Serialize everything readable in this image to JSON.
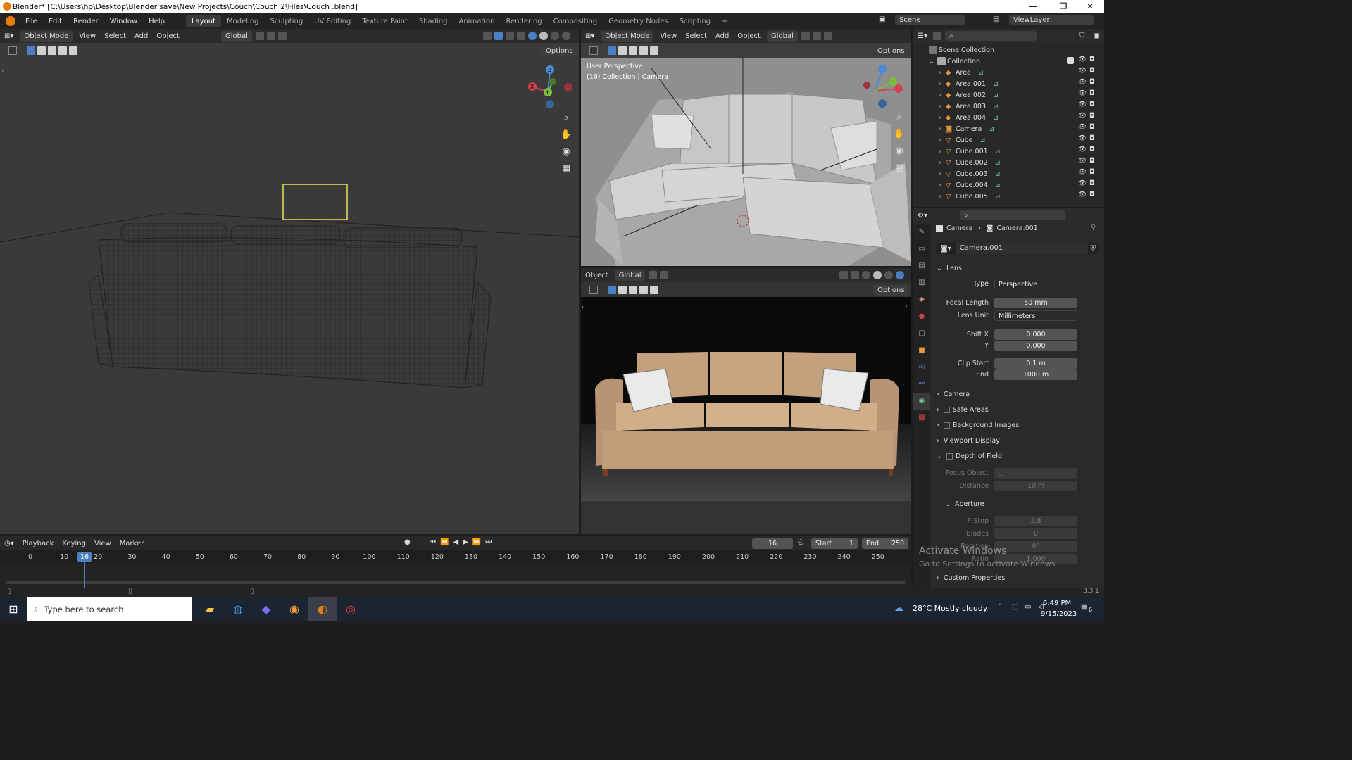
{
  "window": {
    "title": "Blender* [C:\\Users\\hp\\Desktop\\Blender save\\New Projects\\Couch\\Couch 2\\Files\\Couch .blend]",
    "minimize": "—",
    "maximize": "❐",
    "close": "✕"
  },
  "menus": [
    "File",
    "Edit",
    "Render",
    "Window",
    "Help"
  ],
  "workspaces": [
    "Layout",
    "Modeling",
    "Sculpting",
    "UV Editing",
    "Texture Paint",
    "Shading",
    "Animation",
    "Rendering",
    "Compositing",
    "Geometry Nodes",
    "Scripting"
  ],
  "scene": {
    "label": "Scene",
    "view_layer": "ViewLayer"
  },
  "left_viewport": {
    "mode": "Object Mode",
    "menus": [
      "View",
      "Select",
      "Add",
      "Object"
    ],
    "orientation": "Global",
    "options": "Options"
  },
  "right_top_viewport": {
    "mode": "Object Mode",
    "menus": [
      "View",
      "Select",
      "Add",
      "Object"
    ],
    "orientation": "Global",
    "options": "Options",
    "overlay_line1": "User Perspective",
    "overlay_line2": "(16) Collection | Camera"
  },
  "right_bottom_viewport": {
    "menu": "Object",
    "orientation": "Global",
    "options": "Options"
  },
  "gizmo": {
    "z": "Z",
    "y": "Y",
    "x": "X"
  },
  "outliner": {
    "scene_collection": "Scene Collection",
    "collection": "Collection",
    "items": [
      {
        "name": "Area",
        "type": "light"
      },
      {
        "name": "Area.001",
        "type": "light"
      },
      {
        "name": "Area.002",
        "type": "light"
      },
      {
        "name": "Area.003",
        "type": "light"
      },
      {
        "name": "Area.004",
        "type": "light"
      },
      {
        "name": "Camera",
        "type": "camera"
      },
      {
        "name": "Cube",
        "type": "mesh"
      },
      {
        "name": "Cube.001",
        "type": "mesh"
      },
      {
        "name": "Cube.002",
        "type": "mesh"
      },
      {
        "name": "Cube.003",
        "type": "mesh"
      },
      {
        "name": "Cube.004",
        "type": "mesh"
      },
      {
        "name": "Cube.005",
        "type": "mesh"
      }
    ]
  },
  "properties": {
    "breadcrumb_obj": "Camera",
    "breadcrumb_data": "Camera.001",
    "datablock": "Camera.001",
    "lens": {
      "header": "Lens",
      "type_label": "Type",
      "type_value": "Perspective",
      "focal_label": "Focal Length",
      "focal_value": "50 mm",
      "unit_label": "Lens Unit",
      "unit_value": "Millimeters",
      "shiftx_label": "Shift X",
      "shiftx_value": "0.000",
      "y_label": "Y",
      "y_value": "0.000",
      "clip_start_label": "Clip Start",
      "clip_start_value": "0.1 m",
      "end_label": "End",
      "end_value": "1000 m"
    },
    "sections": {
      "camera": "Camera",
      "safe_areas": "Safe Areas",
      "background_images": "Background Images",
      "viewport_display": "Viewport Display",
      "dof": "Depth of Field",
      "focus_object": "Focus Object",
      "distance_label": "Distance",
      "distance_value": "10 m",
      "aperture": "Aperture",
      "fstop_label": "F-Stop",
      "fstop_value": "2.8",
      "blades_label": "Blades",
      "blades_value": "0",
      "rotation_label": "Rotation",
      "rotation_value": "0°",
      "ratio_label": "Ratio",
      "ratio_value": "1.000",
      "custom_props": "Custom Properties"
    }
  },
  "timeline": {
    "menus": [
      "Playback",
      "Keying",
      "View",
      "Marker"
    ],
    "current_frame": "16",
    "start_label": "Start",
    "start_value": "1",
    "end_label": "End",
    "end_value": "250",
    "ticks": [
      "0",
      "10",
      "20",
      "30",
      "40",
      "50",
      "60",
      "70",
      "80",
      "90",
      "100",
      "110",
      "120",
      "130",
      "140",
      "150",
      "160",
      "170",
      "180",
      "190",
      "200",
      "210",
      "220",
      "230",
      "240",
      "250"
    ],
    "playhead": "16"
  },
  "version": "3.3.1",
  "watermark": {
    "line1": "Activate Windows",
    "line2": "Go to Settings to activate Windows."
  },
  "taskbar": {
    "search_placeholder": "Type here to search",
    "weather": "28°C  Mostly cloudy",
    "time": "6:49 PM",
    "date": "9/15/2023",
    "notifications": "6"
  }
}
